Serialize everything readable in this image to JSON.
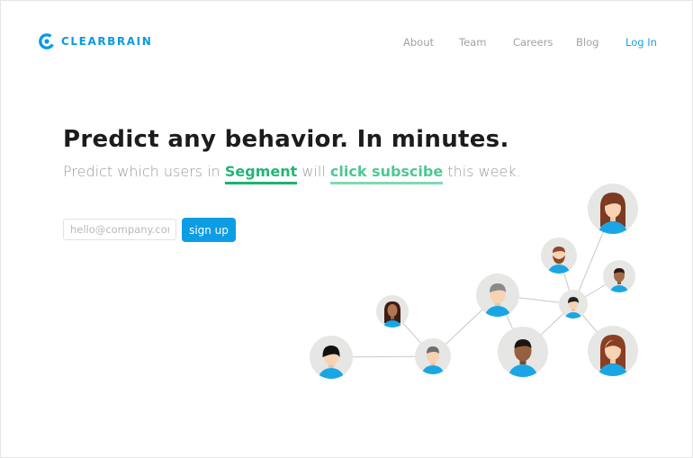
{
  "brand": {
    "name": "CLEARBRAIN",
    "color": "#0b9be0"
  },
  "nav": {
    "items": [
      "About",
      "Team",
      "Careers",
      "Blog"
    ],
    "login": "Log In"
  },
  "hero": {
    "headline": "Predict any behavior. In minutes.",
    "sub_prefix": "Predict which users in",
    "source": "Segment",
    "sub_middle": "will",
    "action": "click subscibe",
    "sub_suffix": "this week."
  },
  "signup": {
    "placeholder": "hello@company.com",
    "button": "sign up"
  },
  "colors": {
    "accent": "#0d9de4",
    "highlight_primary": "#1fb26f",
    "highlight_secondary": "#7fd9b3",
    "avatar_bg": "#e6e6e4",
    "shirt": "#1aa6e5"
  }
}
